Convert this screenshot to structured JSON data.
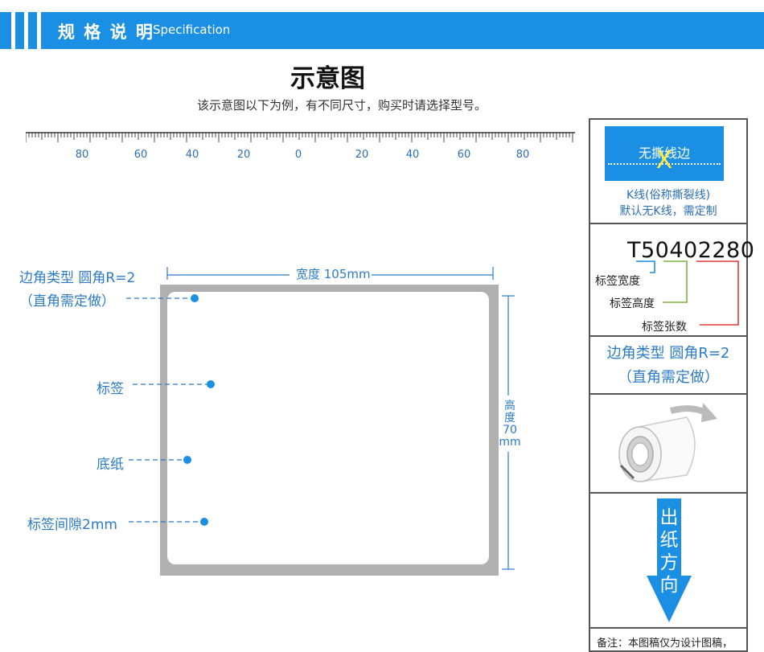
{
  "header": {
    "title": "规 格 说 明",
    "subtitle": "Specification"
  },
  "main_title": "示意图",
  "subtitle": "该示意图以下为例，有不同尺寸，购买时请选择型号。",
  "ruler": {
    "numbers": [
      "80",
      "60",
      "40",
      "20",
      "0",
      "20",
      "40",
      "60",
      "80"
    ]
  },
  "dimensions": {
    "width": "宽度 105mm",
    "height_chars": [
      "高",
      "度",
      "70",
      "mm"
    ]
  },
  "callouts": {
    "corner_line1": "边角类型 圆角R=2",
    "corner_line2": "（直角需定做）",
    "label": "标签",
    "backing": "底纸",
    "gap": "标签间隙2mm"
  },
  "right_panel": {
    "tear_edge": "无撕线边",
    "tear_mark": "X",
    "kline_line1": "K线(俗称撕裂线)",
    "kline_line2": "默认无K线，需定制",
    "model_code": "T50402280",
    "model_width": "标签宽度",
    "model_height": "标签高度",
    "model_count": "标签张数",
    "corner_line1": "边角类型 圆角R=2",
    "corner_line2": "（直角需定做）",
    "direction_chars": [
      "出",
      "纸",
      "方",
      "向"
    ],
    "note": "备注：本图稿仅为设计图稿，"
  },
  "colors": {
    "accent": "#1a8fe4",
    "label_text": "#2b7bc8",
    "green": "#7cb342",
    "red": "#e53935",
    "gray_backing": "#b0b0b0"
  }
}
